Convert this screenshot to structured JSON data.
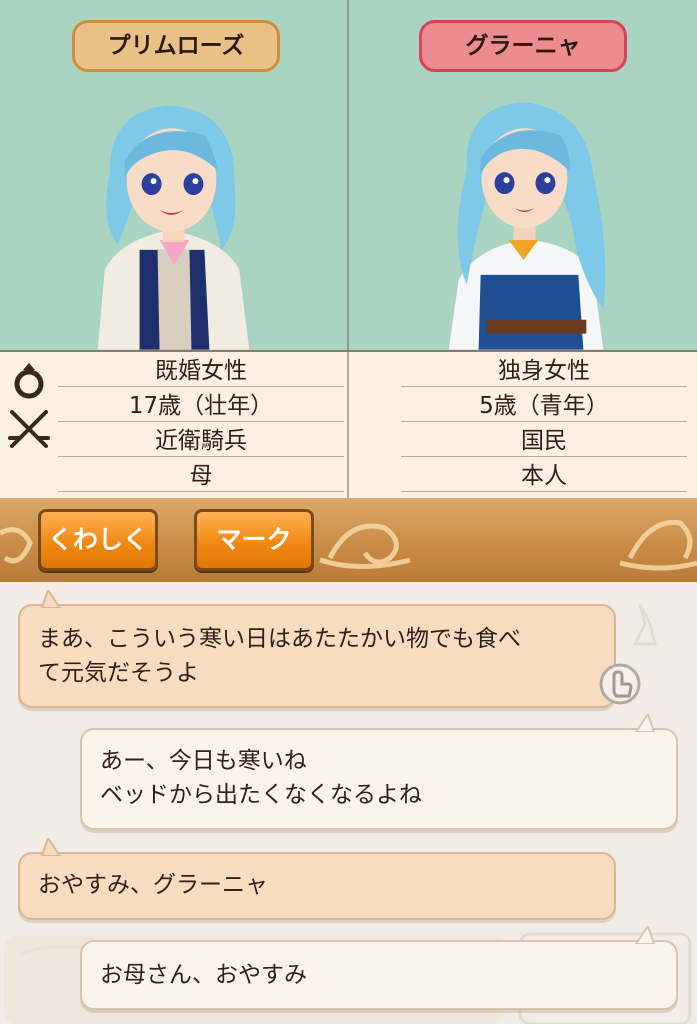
{
  "characters": {
    "left": {
      "name": "プリムローズ",
      "hair": "#7ec8e8",
      "accent": "#eac089"
    },
    "right": {
      "name": "グラーニャ",
      "hair": "#7ec8e8",
      "accent": "#ec8c90"
    }
  },
  "profile_icons": [
    "ring-icon",
    "crossed-swords-icon"
  ],
  "profile": {
    "left": [
      "既婚女性",
      "17歳（壮年）",
      "近衛騎兵",
      "母"
    ],
    "right": [
      "独身女性",
      "5歳（青年）",
      "国民",
      "本人"
    ]
  },
  "toolbar": {
    "detail_label": "くわしく",
    "mark_label": "マーク"
  },
  "chat": [
    {
      "speaker": "left",
      "lines": [
        "まあ、こういう寒い日はあたたかい物でも食べ",
        "て元気だそうよ"
      ]
    },
    {
      "speaker": "right",
      "lines": [
        "あー、今日も寒いね",
        "ベッドから出たくなくなるよね"
      ]
    },
    {
      "speaker": "left",
      "lines": [
        "おやすみ、グラーニャ"
      ]
    },
    {
      "speaker": "right",
      "lines": [
        "お母さん、おやすみ"
      ]
    }
  ],
  "colors": {
    "panel_bg": "#a9d4c2",
    "bubble_left": "#f7dcc0",
    "bubble_right": "#fbf4ea",
    "button": "#f08a14"
  }
}
